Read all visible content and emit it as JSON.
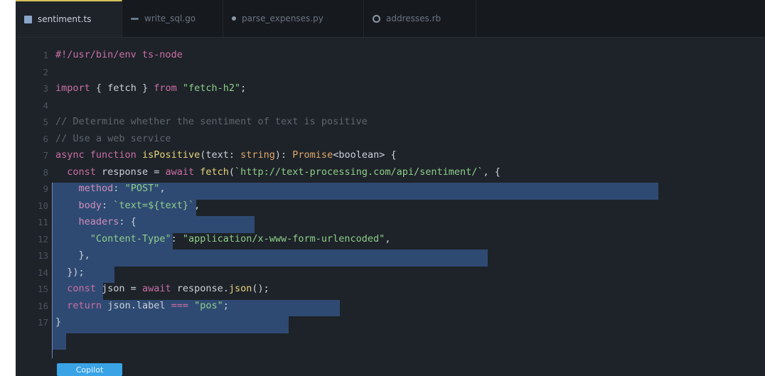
{
  "tabs": [
    {
      "label": "sentiment.ts",
      "icon": "file-icon",
      "active": true
    },
    {
      "label": "write_sql.go",
      "icon": "dash-icon",
      "active": false
    },
    {
      "label": "parse_expenses.py",
      "icon": "dot-icon",
      "active": false
    },
    {
      "label": "addresses.rb",
      "icon": "gear-icon",
      "active": false
    }
  ],
  "editor": {
    "lines": [
      {
        "n": "1",
        "text": "#!/usr/bin/env ts-node"
      },
      {
        "n": "2",
        "text": ""
      },
      {
        "n": "3",
        "text": "import { fetch } from \"fetch-h2\";"
      },
      {
        "n": "4",
        "text": ""
      },
      {
        "n": "5",
        "text": "// Determine whether the sentiment of text is positive"
      },
      {
        "n": "6",
        "text": "// Use a web service"
      },
      {
        "n": "7",
        "text": "async function isPositive(text: string): Promise<boolean> {"
      },
      {
        "n": "8",
        "text": "  const response = await fetch(`http://text-processing.com/api/sentiment/`, {"
      },
      {
        "n": "9",
        "text": "    method: \"POST\","
      },
      {
        "n": "10",
        "text": "    body: `text=${text}`,"
      },
      {
        "n": "11",
        "text": "    headers: {"
      },
      {
        "n": "12",
        "text": "      \"Content-Type\": \"application/x-www-form-urlencoded\","
      },
      {
        "n": "13",
        "text": "    },"
      },
      {
        "n": "14",
        "text": "  });"
      },
      {
        "n": "15",
        "text": "  const json = await response.json();"
      },
      {
        "n": "16",
        "text": "  return json.label === \"pos\";"
      },
      {
        "n": "17",
        "text": "}"
      }
    ]
  },
  "status_button": {
    "label": "Copilot"
  },
  "colors": {
    "editor_bg": "#1e2329",
    "selection": "#2f4a72",
    "accent": "#3aa3e6"
  }
}
